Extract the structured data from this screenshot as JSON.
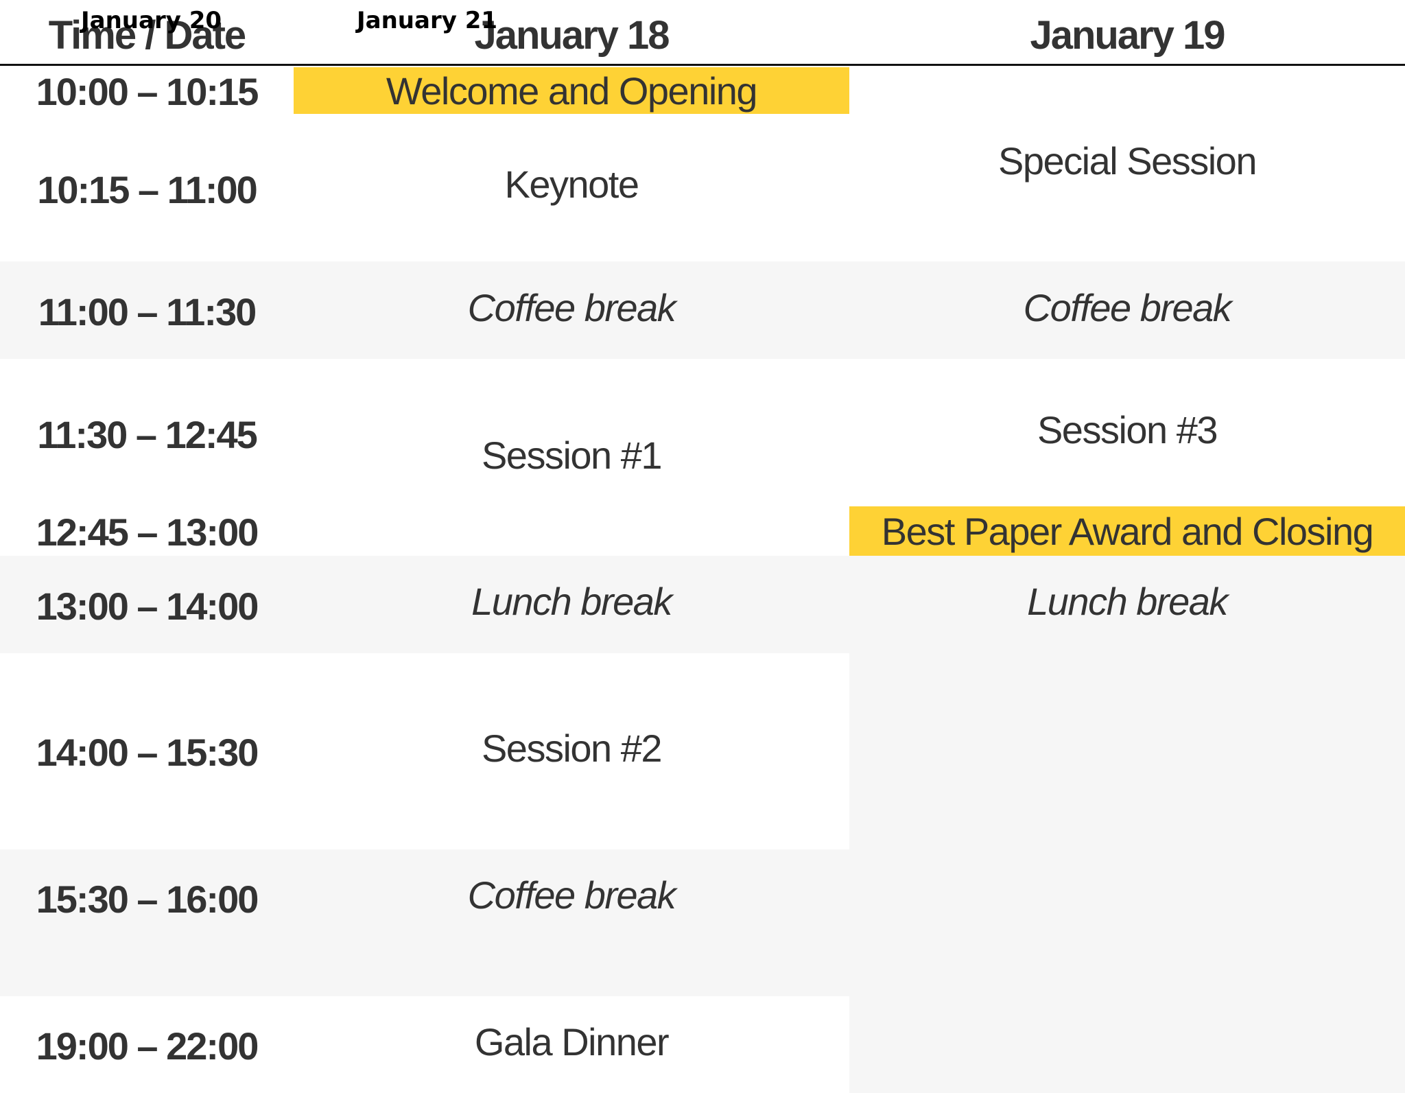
{
  "header": {
    "time_date_label": "Time / Date",
    "day1": "January 18",
    "day2": "January 19",
    "overlay_left": "January 20",
    "overlay_right": "January 21"
  },
  "times": [
    "10:00 – 10:15",
    "10:15 – 11:00",
    "11:00 – 11:30",
    "11:30 – 12:45",
    "12:45 – 13:00",
    "13:00 – 14:00",
    "14:00 – 15:30",
    "15:30 – 16:00",
    "19:00 – 22:00"
  ],
  "day1_events": {
    "welcome": "Welcome and Opening",
    "keynote": "Keynote",
    "coffee1": "Coffee break",
    "session1": "Session #1",
    "lunch": "Lunch break",
    "session2": "Session #2",
    "coffee2": "Coffee break",
    "gala": "Gala Dinner"
  },
  "day2_events": {
    "special": "Special Session",
    "coffee": "Coffee break",
    "session3": "Session #3",
    "closing": "Best Paper Award and Closing",
    "lunch": "Lunch break"
  },
  "colors": {
    "highlight": "#fed235",
    "alt_row": "#f6f6f6",
    "text": "#333333"
  }
}
